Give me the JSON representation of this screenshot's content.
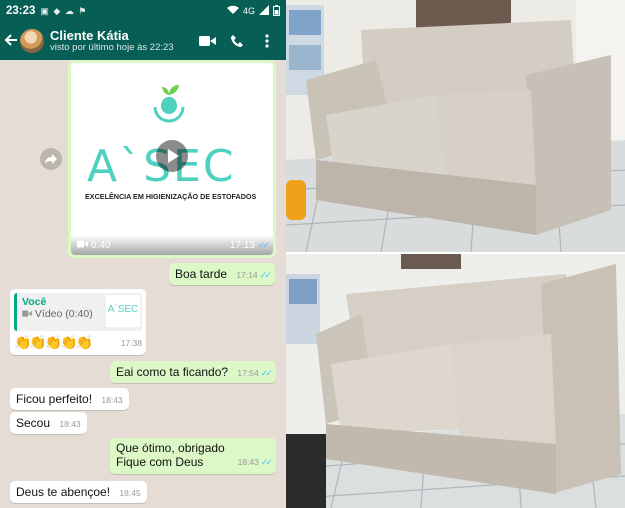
{
  "status": {
    "time": "23:23",
    "signal": "4G"
  },
  "header": {
    "contact_name": "Cliente Kátia",
    "last_seen": "visto por último hoje às 22:23"
  },
  "video_message": {
    "brand": "A`SEC",
    "tagline": "EXCELÊNCIA EM HIGIENIZAÇÃO DE ESTOFADOS",
    "duration": "0:40",
    "time": "17:13"
  },
  "messages": [
    {
      "text": "Boa tarde",
      "time": "17:14"
    },
    {
      "reply_who": "Você",
      "reply_what": "Vídeo (0:40)",
      "reply_thumb": "A`SEC",
      "text": "👏👏👏👏👏",
      "time": "17:38"
    },
    {
      "text": "Eai como ta ficando?",
      "time": "17:54"
    },
    {
      "text": "Ficou perfeito!",
      "time": "18:43"
    },
    {
      "text": "Secou",
      "time": "18:43"
    },
    {
      "line1": "Que ótimo, obrigado",
      "line2": "Fique com Deus",
      "time": "18:43"
    },
    {
      "text": "Deus te abençoe!",
      "time": "18:45"
    }
  ],
  "colors": {
    "header": "#075e54",
    "outgoing": "#dcf8c6",
    "incoming": "#ffffff",
    "chat_bg": "#e5ddd5",
    "brand": "#4fd1c0"
  }
}
